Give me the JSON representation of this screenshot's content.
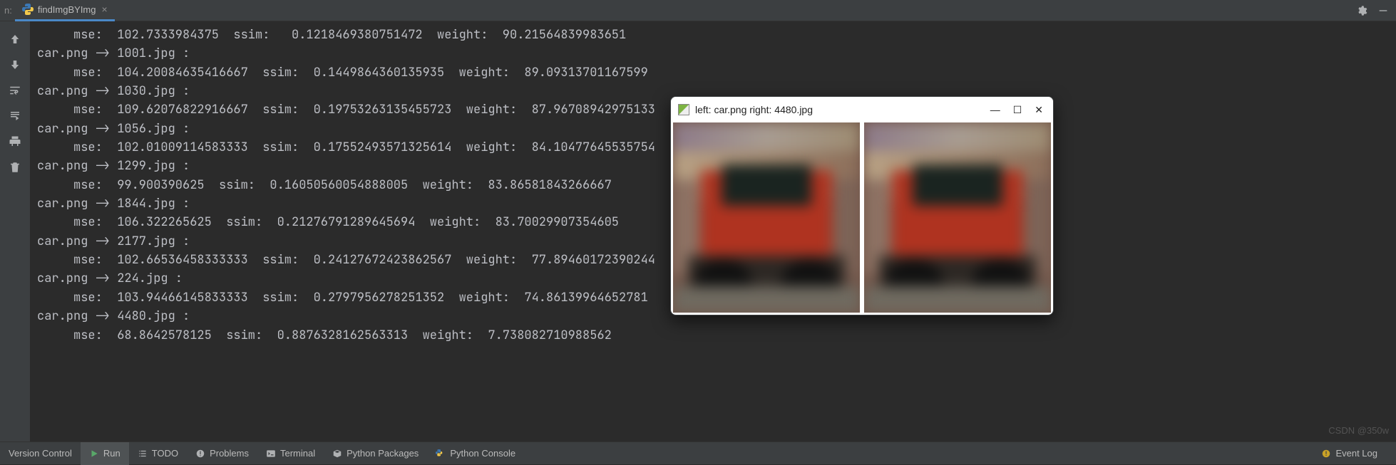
{
  "header": {
    "left_label": "n:",
    "tab_name": "findImgBYImg"
  },
  "console_text": "     mse:  102.7333984375  ssim:   0.1218469380751472  weight:  90.21564839983651\ncar.png -> 1001.jpg :\n     mse:  104.20084635416667  ssim:  0.1449864360135935  weight:  89.09313701167599\ncar.png -> 1030.jpg :\n     mse:  109.62076822916667  ssim:  0.19753263135455723  weight:  87.96708942975133\ncar.png -> 1056.jpg :\n     mse:  102.01009114583333  ssim:  0.17552493571325614  weight:  84.10477645535754\ncar.png -> 1299.jpg :\n     mse:  99.900390625  ssim:  0.16050560054888005  weight:  83.86581843266667\ncar.png -> 1844.jpg :\n     mse:  106.322265625  ssim:  0.21276791289645694  weight:  83.70029907354605\ncar.png -> 2177.jpg :\n     mse:  102.66536458333333  ssim:  0.24127672423862567  weight:  77.89460172390244\ncar.png -> 224.jpg :\n     mse:  103.94466145833333  ssim:  0.2797956278251352  weight:  74.86139964652781\ncar.png -> 4480.jpg :\n     mse:  68.8642578125  ssim:  0.8876328162563313  weight:  7.738082710988562",
  "popup": {
    "title": "left: car.png    right: 4480.jpg"
  },
  "bottom": {
    "version_control": "Version Control",
    "run": "Run",
    "todo": "TODO",
    "problems": "Problems",
    "terminal": "Terminal",
    "packages": "Python Packages",
    "console": "Python Console",
    "event_log": "Event Log"
  },
  "watermark": "CSDN @350w"
}
